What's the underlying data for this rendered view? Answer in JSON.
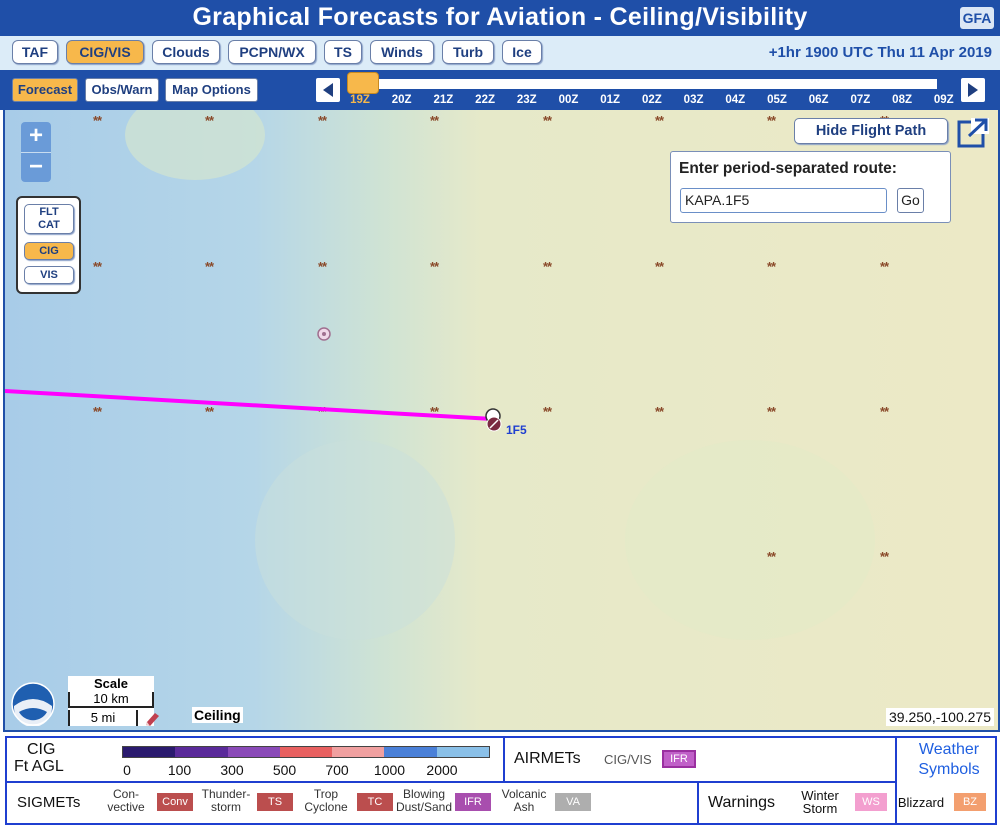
{
  "header": {
    "title": "Graphical Forecasts for Aviation - Ceiling/Visibility",
    "badge": "GFA"
  },
  "products": [
    {
      "label": "TAF"
    },
    {
      "label": "CIG/VIS",
      "active": true
    },
    {
      "label": "Clouds"
    },
    {
      "label": "PCPN/WX"
    },
    {
      "label": "TS"
    },
    {
      "label": "Winds"
    },
    {
      "label": "Turb"
    },
    {
      "label": "Ice"
    }
  ],
  "datetime": "+1hr 1900 UTC Thu 11 Apr 2019",
  "timebar": {
    "tabs": [
      {
        "label": "Forecast",
        "active": true
      },
      {
        "label": "Obs/Warn"
      },
      {
        "label": "Map Options"
      }
    ],
    "hours": [
      "19Z",
      "20Z",
      "21Z",
      "22Z",
      "23Z",
      "00Z",
      "01Z",
      "02Z",
      "03Z",
      "04Z",
      "05Z",
      "06Z",
      "07Z",
      "08Z",
      "09Z"
    ],
    "selected": "19Z"
  },
  "map": {
    "zoom_in": "+",
    "zoom_out": "−",
    "layer_buttons": [
      {
        "label": "FLT CAT"
      },
      {
        "label": "CIG",
        "active": true
      },
      {
        "label": "VIS"
      }
    ],
    "hide_flight_path": "Hide Flight Path",
    "route": {
      "label": "Enter period-separated route:",
      "value": "KAPA.1F5",
      "go": "Go"
    },
    "route_point": "1F5",
    "weather_symbol": "**",
    "scale": {
      "title": "Scale",
      "km": "10 km",
      "mi": "5 mi"
    },
    "layer_name": "Ceiling",
    "coords": "39.250,-100.275",
    "route_color": "#ff00ff"
  },
  "legend": {
    "cig_title": "CIG",
    "cig_unit": "Ft AGL",
    "cig_ticks": [
      "0",
      "100",
      "300",
      "500",
      "700",
      "1000",
      "2000"
    ],
    "cig_colors": [
      "#2a1a6e",
      "#5a2a9a",
      "#8a4ab8",
      "#e86060",
      "#f0a0a0",
      "#4a80d8",
      "#8ac0e8"
    ],
    "airmets": "AIRMETs",
    "airmet_item": "CIG/VIS",
    "airmet_box": "IFR",
    "weather_symbols": "Weather Symbols",
    "sigmets": "SIGMETs",
    "sigmet_items": [
      {
        "label": "Con-vective",
        "box": "Conv",
        "color": "#b03030"
      },
      {
        "label": "Thunder-storm",
        "box": "TS",
        "color": "#b03030"
      },
      {
        "label": "Trop Cyclone",
        "box": "TC",
        "color": "#b03030"
      },
      {
        "label": "Blowing Dust/Sand",
        "box": "IFR",
        "color": "#9a30a0"
      },
      {
        "label": "Volcanic Ash",
        "box": "VA",
        "color": "#a0a0a0"
      }
    ],
    "warnings": "Warnings",
    "warning_items": [
      {
        "label": "Winter Storm",
        "box": "WS",
        "color": "#f080c0"
      },
      {
        "label": "Blizzard",
        "box": "BZ",
        "color": "#f08040"
      }
    ]
  }
}
